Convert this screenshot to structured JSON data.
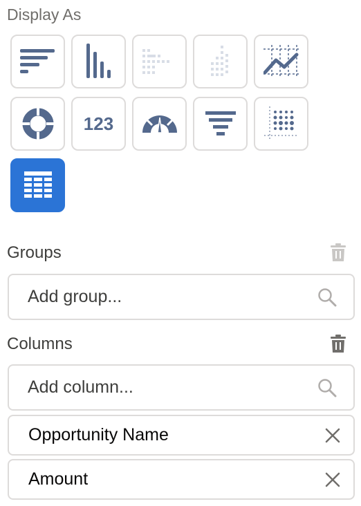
{
  "display_as": {
    "label": "Display As",
    "chart_types": [
      {
        "name": "horizontal-bar",
        "icon": "horizontal-bar-chart-icon",
        "active": false,
        "enabled": true
      },
      {
        "name": "vertical-bar",
        "icon": "vertical-bar-chart-icon",
        "active": false,
        "enabled": true
      },
      {
        "name": "stacked-horizontal-bar",
        "icon": "stacked-horizontal-bar-icon",
        "active": false,
        "enabled": false
      },
      {
        "name": "stacked-vertical-bar",
        "icon": "stacked-vertical-bar-icon",
        "active": false,
        "enabled": false
      },
      {
        "name": "line",
        "icon": "line-chart-icon",
        "active": false,
        "enabled": true
      },
      {
        "name": "donut",
        "icon": "donut-chart-icon",
        "active": false,
        "enabled": true
      },
      {
        "name": "metric",
        "icon": "metric-icon",
        "label": "123",
        "active": false,
        "enabled": true
      },
      {
        "name": "gauge",
        "icon": "gauge-icon",
        "active": false,
        "enabled": true
      },
      {
        "name": "funnel",
        "icon": "funnel-icon",
        "active": false,
        "enabled": true
      },
      {
        "name": "scatter",
        "icon": "scatter-plot-icon",
        "active": false,
        "enabled": true
      },
      {
        "name": "table",
        "icon": "table-icon",
        "active": true,
        "enabled": true
      }
    ]
  },
  "groups": {
    "label": "Groups",
    "placeholder": "Add group...",
    "trash_enabled": false
  },
  "columns": {
    "label": "Columns",
    "placeholder": "Add column...",
    "trash_enabled": true,
    "items": [
      {
        "label": "Opportunity Name"
      },
      {
        "label": "Amount"
      }
    ]
  },
  "colors": {
    "accent": "#2b74d6",
    "icon_enabled": "#54698d",
    "icon_disabled": "#d8dde6",
    "border": "#dddbda"
  }
}
